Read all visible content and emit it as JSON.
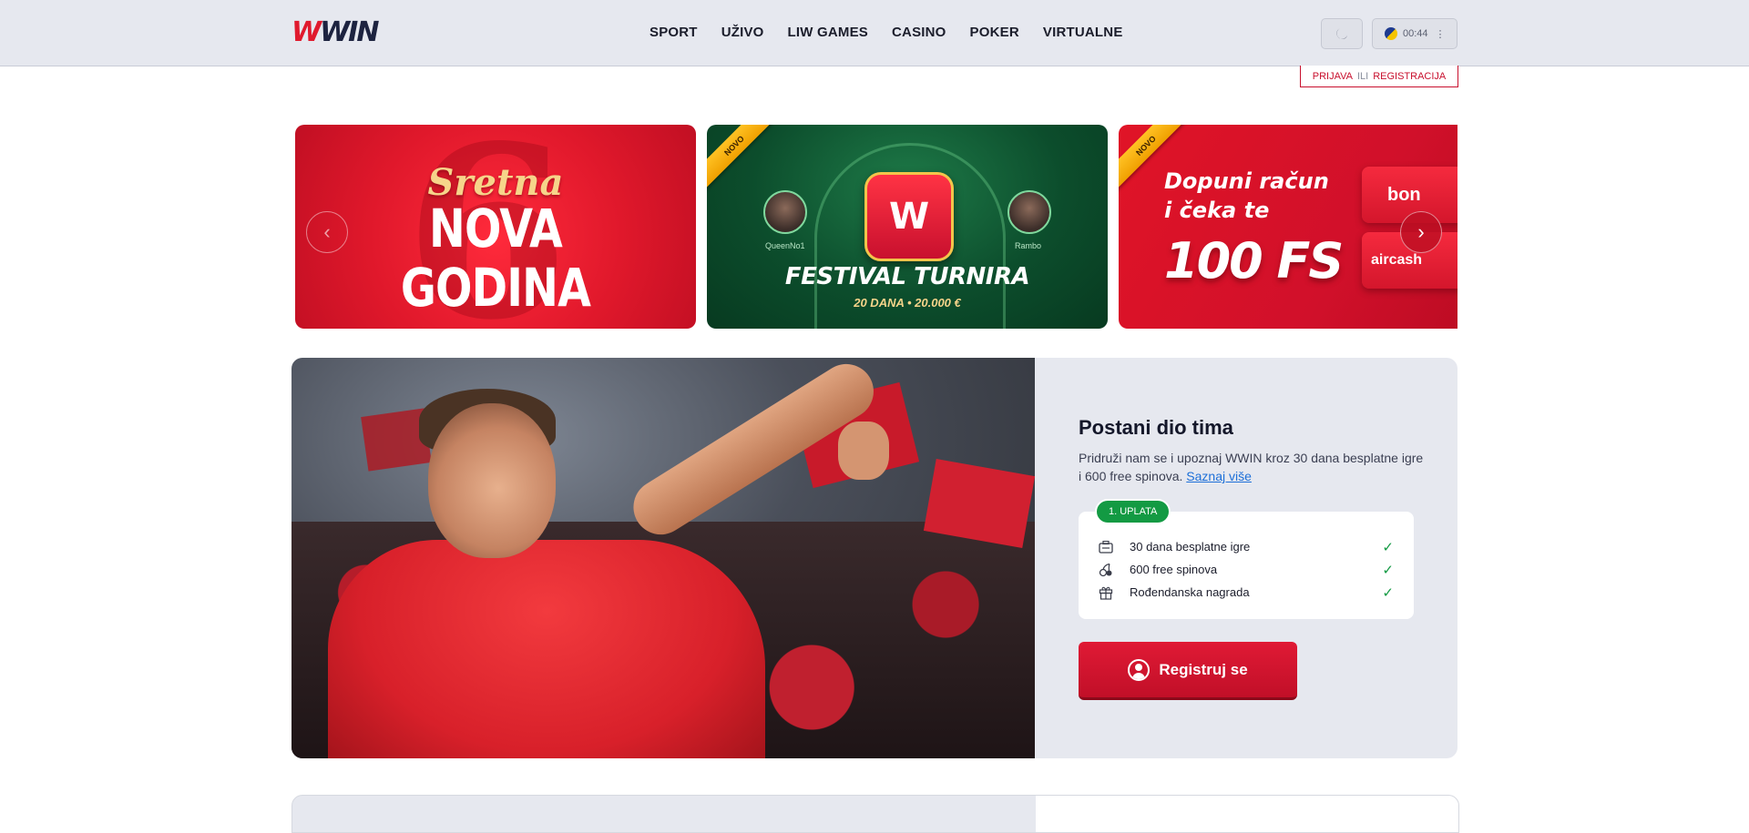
{
  "brand": {
    "logo_a": "W",
    "logo_b": "WIN",
    "primary": "#c8102e",
    "success": "#139a43"
  },
  "nav": [
    {
      "label": "SPORT"
    },
    {
      "label": "UŽIVO"
    },
    {
      "label": "LIW GAMES"
    },
    {
      "label": "CASINO"
    },
    {
      "label": "POKER"
    },
    {
      "label": "VIRTUALNE"
    }
  ],
  "header": {
    "theme_icon": "moon-icon",
    "time": "00:44",
    "more": "⋮",
    "auth": {
      "login": "PRIJAVA",
      "or": "ILI",
      "register": "REGISTRACIJA"
    }
  },
  "carousel": {
    "slides": [
      {
        "line1": "Sretna",
        "line2": "NOVA",
        "line3": "GODINA"
      },
      {
        "badge": "NOVO",
        "player1": "QueenNo1",
        "player2": "Rambo",
        "logo": "W",
        "title": "FESTIVAL TURNIRA",
        "subtitle": "20 DANA  •  20.000 €"
      },
      {
        "badge": "NOVO",
        "line1": "Dopuni račun",
        "line2": "i čeka te",
        "big": "100 FS",
        "pay1": "bon",
        "pay2": "aircash"
      }
    ],
    "prev_icon": "chevron-left-icon",
    "next_icon": "chevron-right-icon"
  },
  "promo": {
    "title": "Postani dio tima",
    "text": "Pridruži nam se i upoznaj WWIN kroz 30 dana  besplatne igre i  600 free spinova.",
    "link": "Saznaj više",
    "badge": "1. UPLATA",
    "features": [
      {
        "icon": "ticket-icon",
        "label": "30 dana besplatne igre"
      },
      {
        "icon": "cherries-icon",
        "label": "600 free spinova"
      },
      {
        "icon": "gift-icon",
        "label": "Rođendanska nagrada"
      }
    ],
    "cta": "Registruj se"
  }
}
